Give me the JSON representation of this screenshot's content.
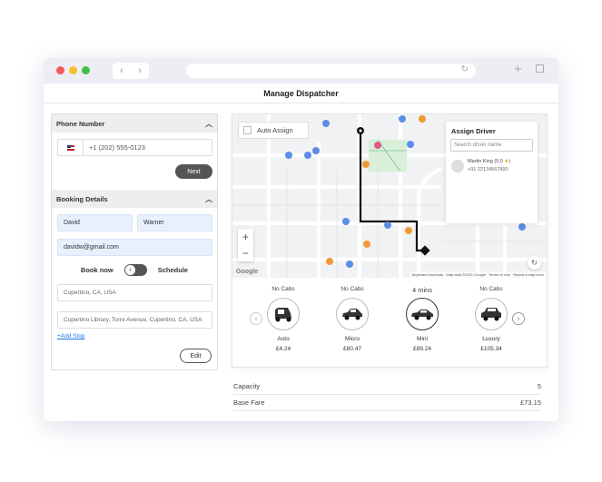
{
  "page_title": "Manage Dispatcher",
  "phone_section": {
    "title": "Phone Number",
    "phone_value": "+1 (202) 555-0123",
    "next_label": "Next"
  },
  "booking_section": {
    "title": "Booking Details",
    "first_name": "David",
    "last_name": "Warner",
    "email": "davidw@gmail.com",
    "book_now_label": "Book now",
    "schedule_label": "Schedule",
    "pickup": "Cupertino, CA, USA",
    "dropoff": "Cupertino Library, Torre Avenue, Cupertino, CA, USA",
    "add_stop_label": "+Add Stop",
    "edit_label": "Edit"
  },
  "map": {
    "auto_assign_label": "Auto Assign",
    "footer_shortcuts": "Keyboard shortcuts",
    "footer_data": "Map data ©2021 Google",
    "footer_terms": "Terms of Use",
    "footer_report": "Report a map error",
    "google_logo": "Google"
  },
  "assign_driver": {
    "title": "Assign Driver",
    "search_placeholder": "Search driver name",
    "driver_name": "Martin King",
    "driver_rating": "(5.0",
    "driver_phone": "+91 22134567890"
  },
  "cabs": [
    {
      "status": "No Cabs",
      "name": "Auto",
      "price": "£4.24",
      "icon": "auto-rickshaw-icon"
    },
    {
      "status": "No Cabs",
      "name": "Micro",
      "price": "£80.47",
      "icon": "micro-car-icon"
    },
    {
      "status": "4 mins",
      "name": "Mini",
      "price": "£89.24",
      "icon": "mini-car-icon"
    },
    {
      "status": "No Cabs",
      "name": "Luxury",
      "price": "£105.34",
      "icon": "luxury-car-icon"
    }
  ],
  "fare": {
    "capacity_label": "Capacity",
    "capacity_value": "5",
    "base_fare_label": "Base Fare",
    "base_fare_value": "£73.15"
  },
  "colors": {
    "accent_dark": "#555555",
    "link_blue": "#1a73e8",
    "input_blue": "#e8f0fe",
    "route": "#111111",
    "map_pin_blue": "#5b8de8",
    "map_pin_orange": "#f09a36",
    "map_pin_pink": "#e05a8c"
  }
}
